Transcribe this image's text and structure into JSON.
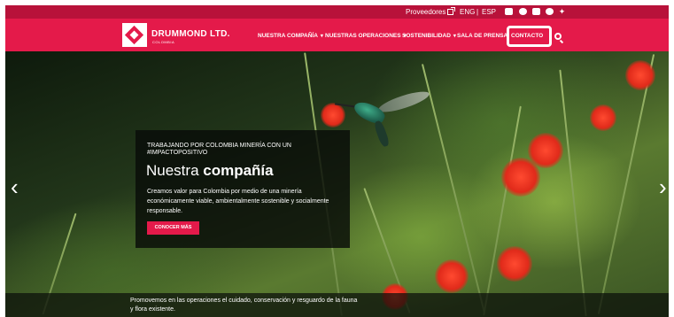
{
  "utility": {
    "proveedores": "Proveedores",
    "lang_eng": "ENG",
    "lang_sep": "|",
    "lang_esp": "ESP",
    "social_icons": [
      "youtube-icon",
      "facebook-icon",
      "linkedin-icon",
      "instagram-icon",
      "twitter-icon"
    ]
  },
  "brand": {
    "name": "DRUMMOND LTD.",
    "sub": "COLOMBIA"
  },
  "nav": {
    "items": [
      {
        "label": "NUESTRA COMPAÑÍA",
        "caret": "▾"
      },
      {
        "label": "NUESTRAS OPERACIONES",
        "caret": "▾"
      },
      {
        "label": "SOSTENIBILIDAD",
        "caret": "▾"
      },
      {
        "label": "SALA DE PRENSA",
        "caret": ""
      }
    ],
    "contact": "CONTACTO"
  },
  "hero": {
    "kicker": "TRABAJANDO POR COLOMBIA MINERÍA CON UN #IMPACTOPOSITIVO",
    "title_light": "Nuestra ",
    "title_bold": "compañía",
    "body": "Creamos valor para Colombia por medio de una minería económicamente viable, ambientalmente sostenible y socialmente responsable.",
    "cta": "CONOCER MÁS",
    "prev_arrow": "‹",
    "next_arrow": "›",
    "caption": "Promovemos en las operaciones el cuidado, conservación y resguardo de la fauna y flora existente."
  },
  "colors": {
    "brand_red": "#e41a4a",
    "utility_red": "#b8123a"
  }
}
